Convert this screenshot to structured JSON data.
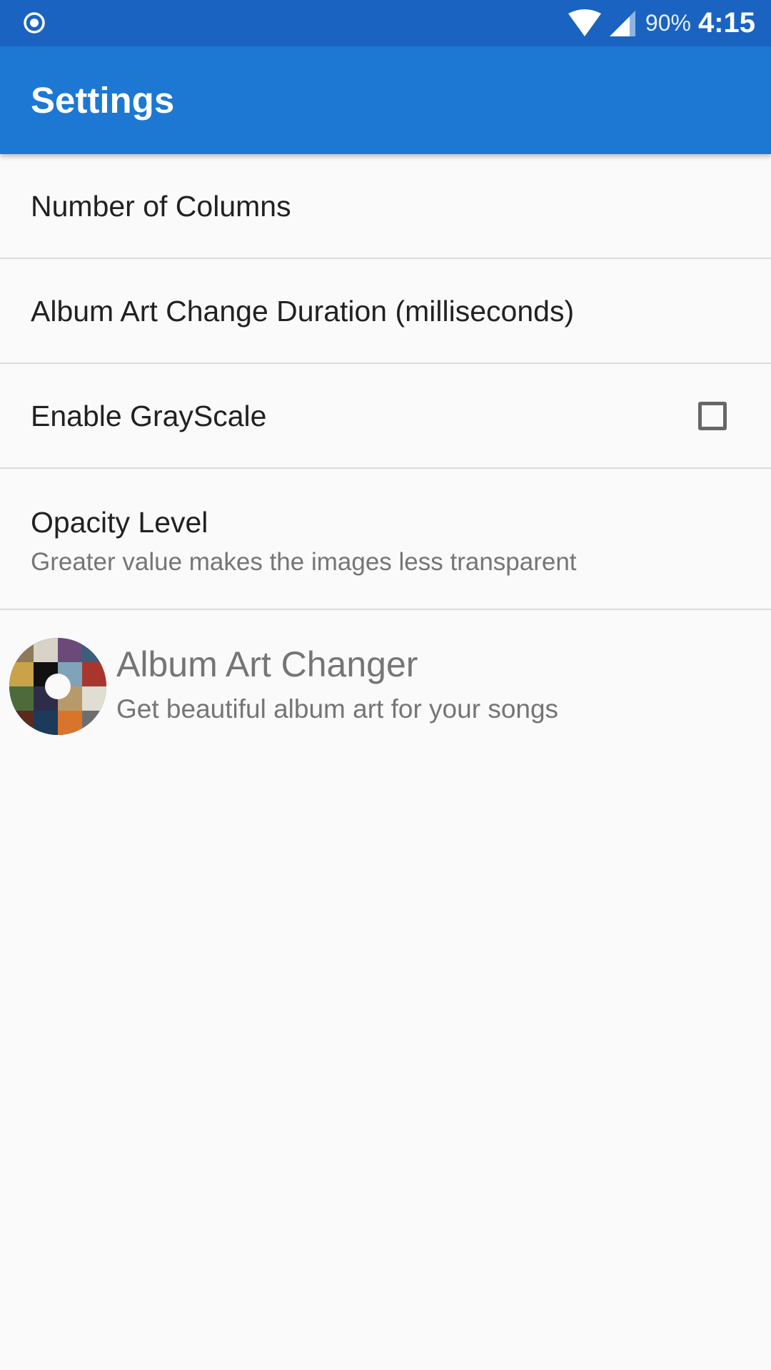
{
  "status_bar": {
    "battery": "90%",
    "time": "4:15",
    "left_icon": "record-icon",
    "wifi_icon": "wifi-icon",
    "signal_icon": "cell-signal-icon"
  },
  "app_bar": {
    "title": "Settings"
  },
  "preferences": [
    {
      "title": "Number of Columns"
    },
    {
      "title": "Album Art Change Duration (milliseconds)"
    },
    {
      "title": "Enable GrayScale",
      "checked": false
    },
    {
      "title": "Opacity Level",
      "summary": "Greater value makes the images less transparent"
    }
  ],
  "about": {
    "title": "Album Art Changer",
    "subtitle": "Get beautiful album art for your songs",
    "icon": "album-art-logo-icon"
  },
  "colors": {
    "status_bar": "#1a63c0",
    "app_bar": "#1c78d2",
    "background": "#fafafa",
    "divider": "#dcdcdc"
  }
}
